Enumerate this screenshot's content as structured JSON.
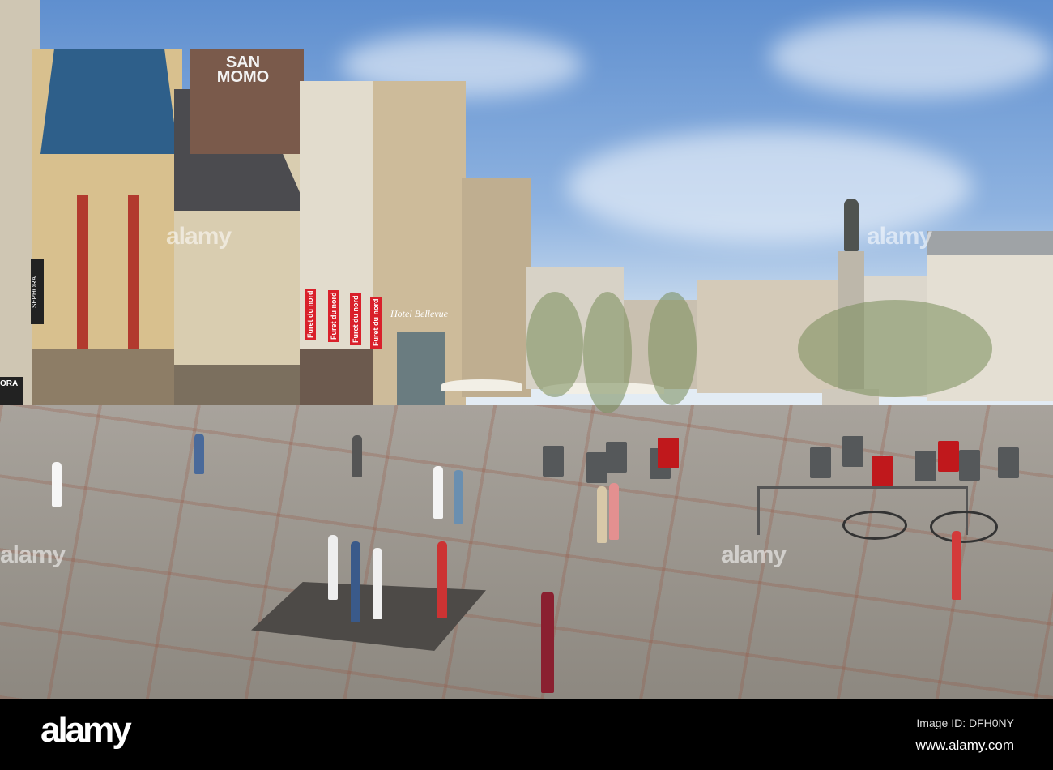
{
  "photo": {
    "signs": {
      "graffiti": "SAN MOMO",
      "sephora": "SEPHORA",
      "sephora_partial": "ORA",
      "furet_banners": [
        "Furet du nord",
        "Furet du nord",
        "Furet du nord",
        "Furet du nord"
      ],
      "hotel": "Hotel Bellevue"
    },
    "watermarks": [
      "alamy",
      "alamy",
      "alamy",
      "alamy"
    ],
    "colors": {
      "sky": "#8fb3e0",
      "banner": "#d9202a",
      "plaza": "#a09a92"
    }
  },
  "footer": {
    "logo": "alamy",
    "image_id": "Image ID: DFH0NY",
    "url": "www.alamy.com"
  }
}
